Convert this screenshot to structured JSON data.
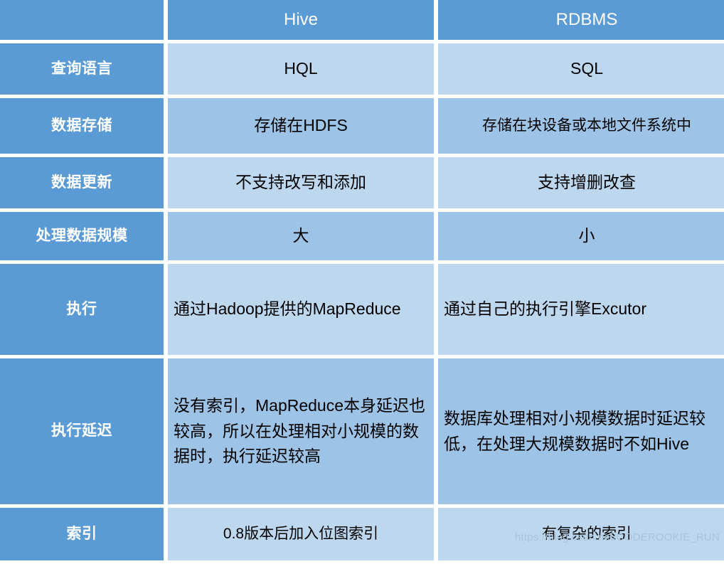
{
  "table": {
    "columns": [
      "",
      "Hive",
      "RDBMS"
    ],
    "header": {
      "label_blank": "",
      "hive": "Hive",
      "rdbms": "RDBMS"
    },
    "rows": [
      {
        "label": "查询语言",
        "hive": "HQL",
        "rdbms": "SQL",
        "tint": "a",
        "align": "center"
      },
      {
        "label": "数据存储",
        "hive": "存储在HDFS",
        "rdbms": "存储在块设备或本地文件系统中",
        "tint": "b",
        "align": "center"
      },
      {
        "label": "数据更新",
        "hive": "不支持改写和添加",
        "rdbms": "支持增删改查",
        "tint": "a",
        "align": "center"
      },
      {
        "label": "处理数据规模",
        "hive": "大",
        "rdbms": "小",
        "tint": "b",
        "align": "center"
      },
      {
        "label": "执行",
        "hive": "通过Hadoop提供的MapReduce",
        "rdbms": "通过自己的执行引擎Excutor",
        "tint": "a",
        "align": "left"
      },
      {
        "label": "执行延迟",
        "hive": "没有索引，MapReduce本身延迟也较高，所以在处理相对小规模的数据时，执行延迟较高",
        "rdbms": "数据库处理相对小规模数据时延迟较低，在处理大规模数据时不如Hive",
        "tint": "b",
        "align": "left"
      },
      {
        "label": "索引",
        "hive": "0.8版本后加入位图索引",
        "rdbms": "有复杂的索引",
        "tint": "a",
        "align": "center"
      }
    ]
  },
  "watermark": {
    "text": "https://blog.csdn.net/CODEROOKIE_RUN"
  },
  "colors": {
    "label_blue": "#5B9BD5",
    "tint_light": "#BDD7EE",
    "tint_medium": "#9DC3E6",
    "text": "#000000",
    "header_text": "#FFFFFF",
    "watermark_text": "#A8C4DD",
    "background": "#FFFFFF"
  }
}
